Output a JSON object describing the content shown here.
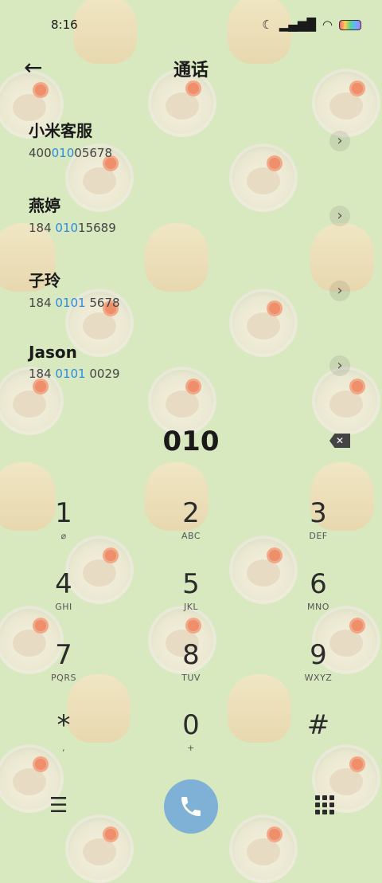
{
  "status_bar": {
    "time": "8:16"
  },
  "header": {
    "back_icon": "back-arrow-icon",
    "title": "通话"
  },
  "contacts": [
    {
      "name": "小米客服",
      "num_before": "400",
      "num_match": "010",
      "num_after": "05678"
    },
    {
      "name": "燕婷",
      "num_before": "184 ",
      "num_match": "010",
      "num_after": "15689"
    },
    {
      "name": "子玲",
      "num_before": "184 ",
      "num_match": "0101",
      "num_after": " 5678"
    },
    {
      "name": "Jason",
      "num_before": "184 ",
      "num_match": "0101",
      "num_after": " 0029"
    }
  ],
  "entry": {
    "digits": "010"
  },
  "keypad": [
    {
      "digit": "1",
      "sub": "⌀"
    },
    {
      "digit": "2",
      "sub": "ABC"
    },
    {
      "digit": "3",
      "sub": "DEF"
    },
    {
      "digit": "4",
      "sub": "GHI"
    },
    {
      "digit": "5",
      "sub": "JKL"
    },
    {
      "digit": "6",
      "sub": "MNO"
    },
    {
      "digit": "7",
      "sub": "PQRS"
    },
    {
      "digit": "8",
      "sub": "TUV"
    },
    {
      "digit": "9",
      "sub": "WXYZ"
    },
    {
      "digit": "*",
      "sub": ","
    },
    {
      "digit": "0",
      "sub": "+"
    },
    {
      "digit": "#",
      "sub": ""
    }
  ],
  "colors": {
    "background": "#d8e8bf",
    "highlight": "#2a8be0",
    "call_button": "#7fb0d6"
  }
}
